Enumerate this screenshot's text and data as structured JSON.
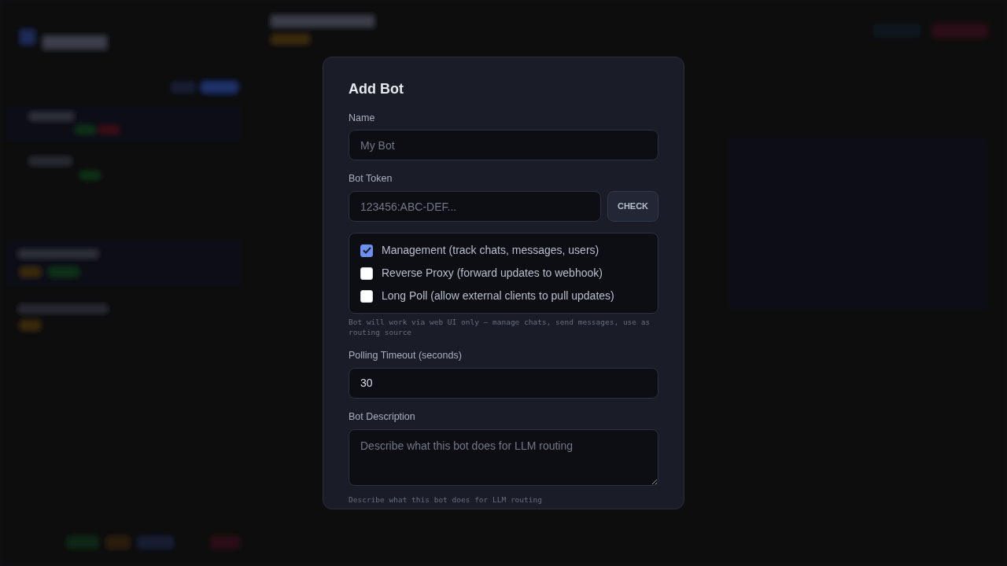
{
  "dialog": {
    "title": "Add Bot",
    "fields": [
      {
        "kind": "text",
        "label": "Name",
        "placeholder": "My Bot"
      },
      {
        "kind": "token",
        "label": "Bot Token",
        "placeholder": "123456:ABC-DEF...",
        "button": "CHECK"
      },
      {
        "kind": "checks",
        "options": [
          {
            "label": "Management (track chats, messages, users)",
            "checked": true
          },
          {
            "label": "Reverse Proxy (forward updates to webhook)",
            "checked": false
          },
          {
            "label": "Long Poll (allow external clients to pull updates)",
            "checked": false
          }
        ],
        "hint": "Bot will work via web UI only — manage chats, send messages, use as routing source"
      },
      {
        "kind": "text",
        "label": "Polling Timeout (seconds)",
        "value": "30"
      },
      {
        "kind": "textarea",
        "label": "Bot Description",
        "placeholder": "Describe what this bot does for LLM routing",
        "hint": "Describe what this bot does for LLM routing"
      }
    ]
  }
}
